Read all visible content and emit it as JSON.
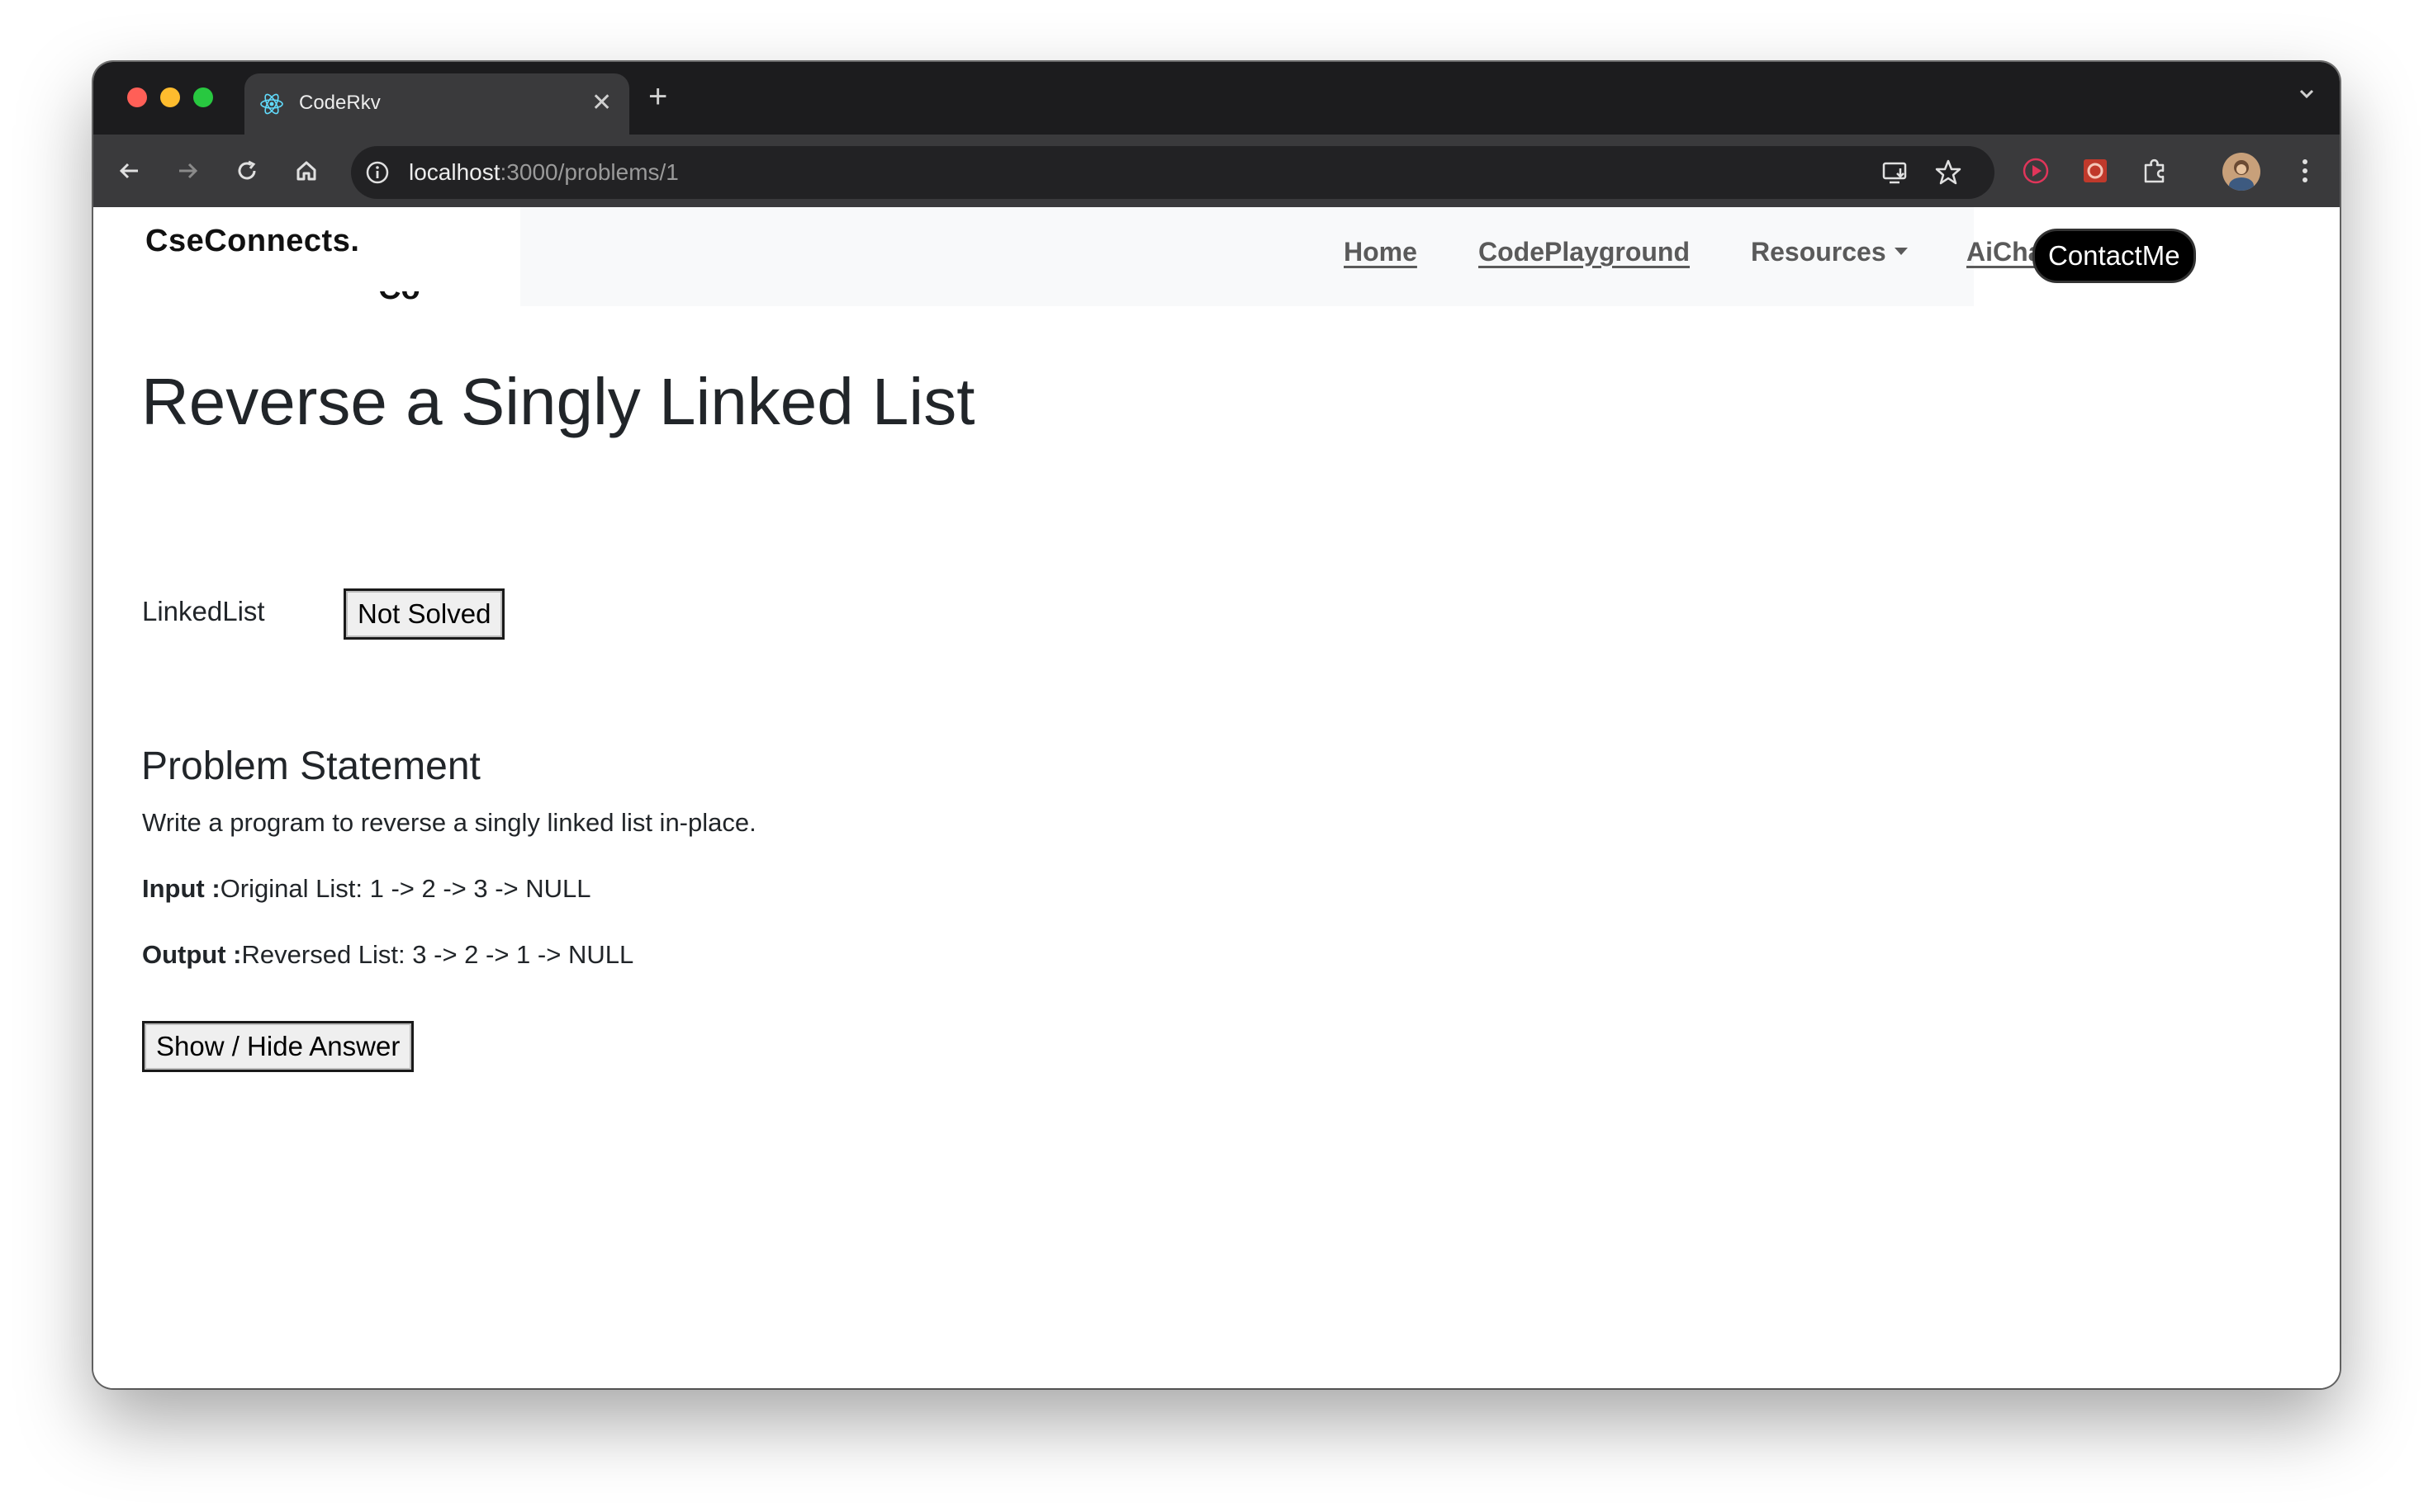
{
  "browser": {
    "tab_title": "CodeRkv",
    "url_host": "localhost",
    "url_path": ":3000/problems/1"
  },
  "site": {
    "brand": "CseConnects.",
    "nav": {
      "home": "Home",
      "playground": "CodePlayground",
      "resources": "Resources",
      "chatbot": "AiChatbot",
      "contact": "ContactMe"
    }
  },
  "problem": {
    "title": "Reverse a Singly Linked List",
    "tag": "LinkedList",
    "status": "Not Solved",
    "section_heading": "Problem Statement",
    "statement": "Write a program to reverse a singly linked list in-place.",
    "input_label": "Input :",
    "input_value": "Original List: 1 -> 2 -> 3 -> NULL",
    "output_label": "Output :",
    "output_value": "Reversed List: 3 -> 2 -> 1 -> NULL",
    "toggle_label": "Show / Hide Answer"
  },
  "icons": {
    "favicon": "react-atom-icon",
    "close": "close-icon",
    "new_tab": "plus-icon",
    "back": "arrow-left-icon",
    "forward": "arrow-right-icon",
    "reload": "reload-icon",
    "home": "home-icon",
    "site_info": "info-icon",
    "install": "install-app-icon",
    "bookmark": "star-icon",
    "extensions": "puzzle-icon",
    "menu": "kebab-menu-icon"
  },
  "colors": {
    "accent_black": "#000000",
    "nav_text": "#5a5a5a",
    "navbar_bg": "#f8f9fa"
  }
}
